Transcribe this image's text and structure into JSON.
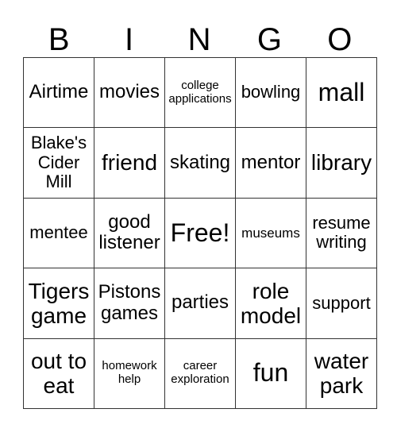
{
  "header": [
    "B",
    "I",
    "N",
    "G",
    "O"
  ],
  "rows": [
    [
      "Airtime",
      "movies",
      "college applications",
      "bowling",
      "mall"
    ],
    [
      "Blake's Cider Mill",
      "friend",
      "skating",
      "mentor",
      "library"
    ],
    [
      "mentee",
      "good listener",
      "Free!",
      "museums",
      "resume writing"
    ],
    [
      "Tigers game",
      "Pistons games",
      "parties",
      "role model",
      "support"
    ],
    [
      "out to eat",
      "homework help",
      "career exploration",
      "fun",
      "water park"
    ]
  ]
}
